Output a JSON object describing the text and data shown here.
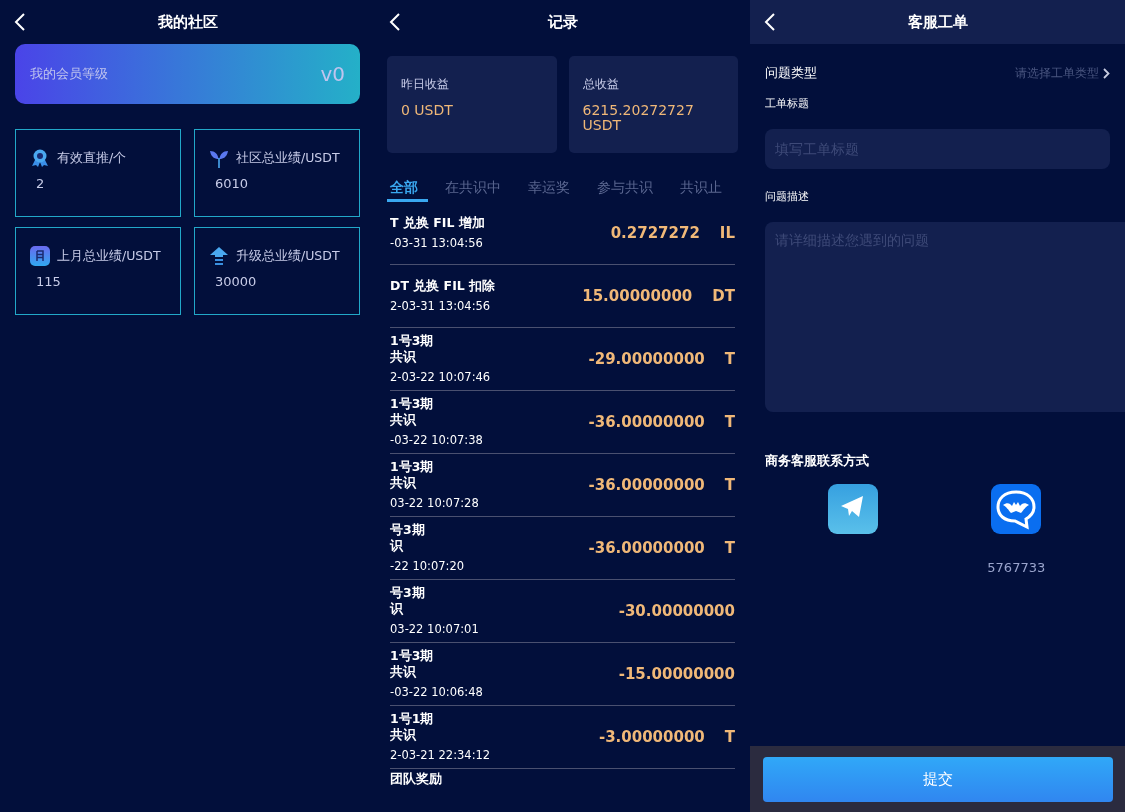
{
  "community": {
    "title": "我的社区",
    "level_card": {
      "label": "我的会员等级",
      "value": "v0"
    },
    "stats": [
      {
        "kind": "award",
        "label": "有效直推/个",
        "value": "2"
      },
      {
        "kind": "sprout",
        "label": "社区总业绩/USDT",
        "value": "6010"
      },
      {
        "kind": "calendar",
        "label": "上月总业绩/USDT",
        "value": "115"
      },
      {
        "kind": "upgrade",
        "label": "升级总业绩/USDT",
        "value": "30000"
      }
    ]
  },
  "records": {
    "title": "记录",
    "summary": [
      {
        "label": "昨日收益",
        "value": "0 USDT"
      },
      {
        "label": "总收益",
        "value": "6215.20272727 USDT"
      }
    ],
    "tabs": [
      {
        "label": "全部",
        "selected": true
      },
      {
        "label": "在共识中",
        "selected": false
      },
      {
        "label": "幸运奖",
        "selected": false
      },
      {
        "label": "参与共识",
        "selected": false
      },
      {
        "label": "共识止",
        "selected": false
      }
    ],
    "rows": [
      {
        "title": "T 兑换 FIL 增加",
        "time": "-03-31 13:04:56",
        "amount": "0.2727272",
        "unit": "IL"
      },
      {
        "title": "DT 兑换 FIL 扣除",
        "time": "2-03-31 13:04:56",
        "amount": "15.00000000",
        "unit": "DT"
      },
      {
        "title": "1号3期",
        "subtitle": "共识",
        "time": "2-03-22 10:07:46",
        "amount": "-29.00000000",
        "unit": "T"
      },
      {
        "title": "1号3期",
        "subtitle": "共识",
        "time": "-03-22 10:07:38",
        "amount": "-36.00000000",
        "unit": "T"
      },
      {
        "title": "1号3期",
        "subtitle": "共识",
        "time": "03-22 10:07:28",
        "amount": "-36.00000000",
        "unit": "T"
      },
      {
        "title": "号3期",
        "subtitle": "识",
        "time": "-22 10:07:20",
        "amount": "-36.00000000",
        "unit": "T"
      },
      {
        "title": "号3期",
        "subtitle": "识",
        "time": "03-22 10:07:01",
        "amount": "-30.00000000"
      },
      {
        "title": "1号3期",
        "subtitle": "共识",
        "time": "-03-22 10:06:48",
        "amount": "-15.00000000"
      },
      {
        "title": "1号1期",
        "subtitle": "共识",
        "time": "2-03-21 22:34:12",
        "amount": "-3.00000000",
        "unit": "T"
      },
      {
        "title": "团队奖励"
      }
    ]
  },
  "ticket": {
    "title": "客服工单",
    "type_label": "问题类型",
    "type_placeholder": "请选择工单类型",
    "title_label": "工单标题",
    "title_placeholder": "填写工单标题",
    "desc_label": "问题描述",
    "desc_placeholder": "请详细描述您遇到的问题",
    "contact_heading": "商务客服联系方式",
    "contacts": [
      {
        "kind": "plane"
      },
      {
        "kind": "bat",
        "id": "5767733"
      }
    ],
    "submit": "提交"
  }
}
